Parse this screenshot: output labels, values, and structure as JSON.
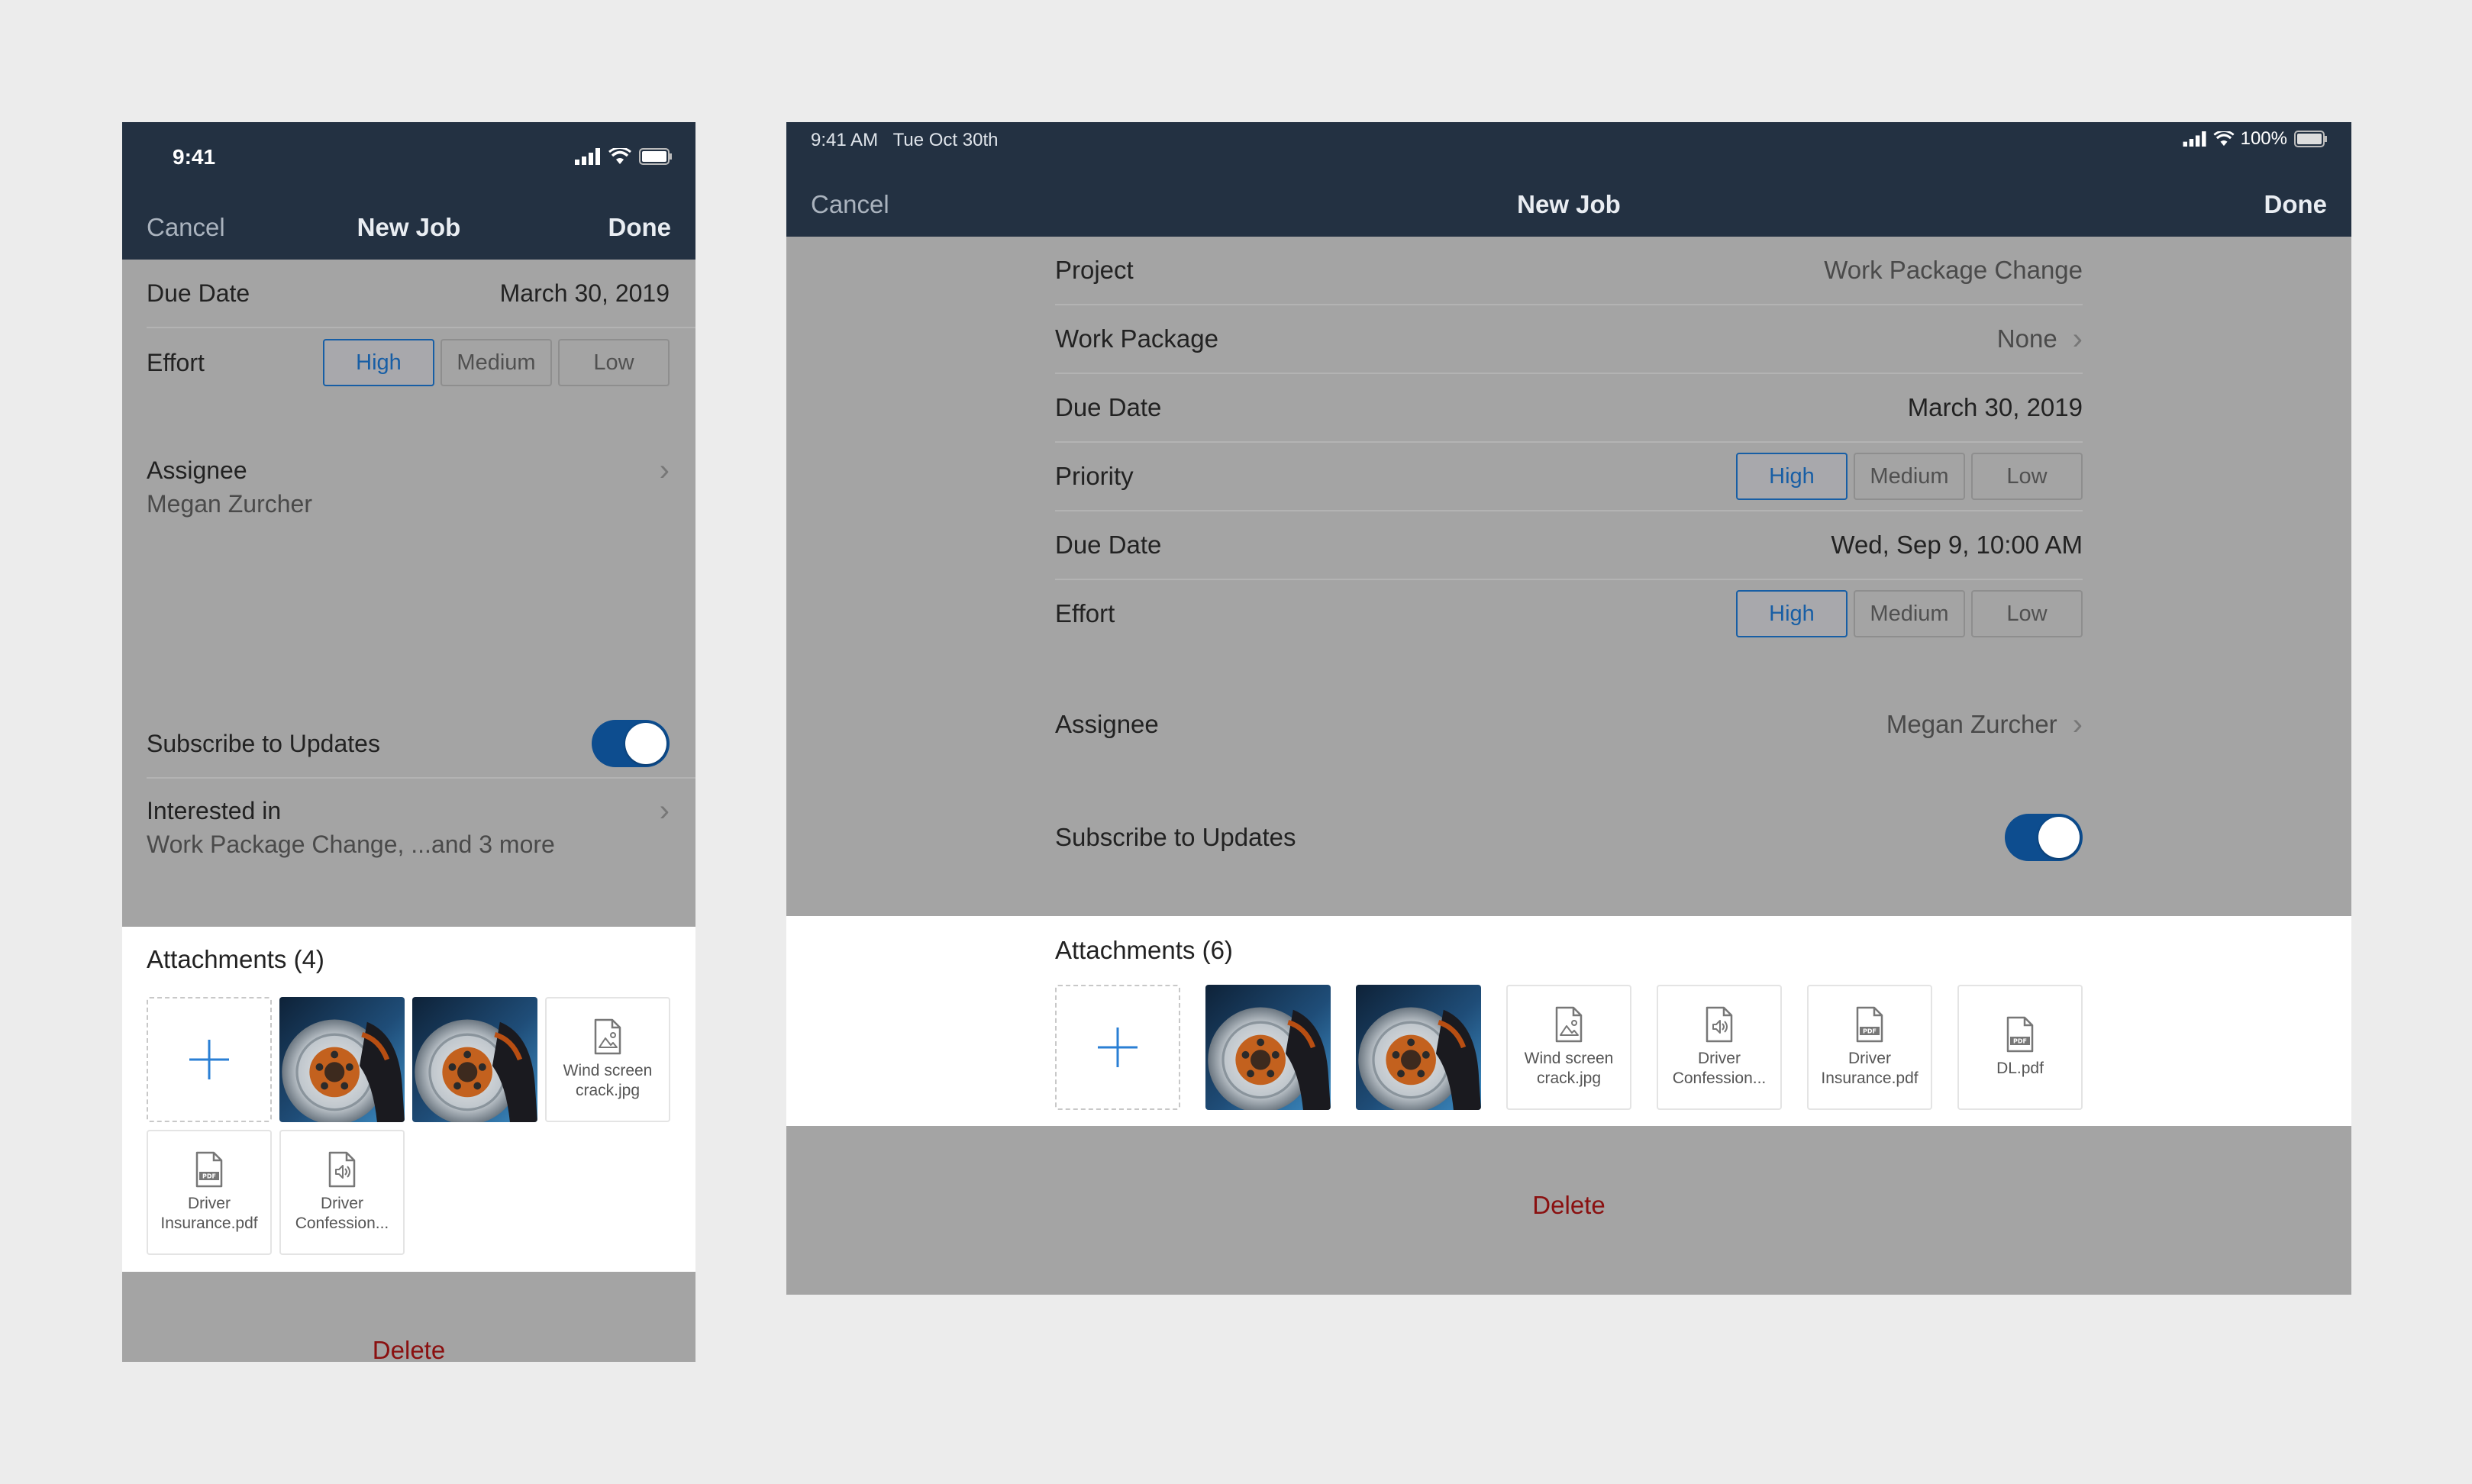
{
  "phone": {
    "status": {
      "time": "9:41"
    },
    "nav": {
      "cancel": "Cancel",
      "title": "New Job",
      "done": "Done"
    },
    "due_date": {
      "label": "Due Date",
      "value": "March 30, 2019"
    },
    "effort": {
      "label": "Effort",
      "options": [
        "High",
        "Medium",
        "Low"
      ],
      "selected": "High"
    },
    "assignee": {
      "label": "Assignee",
      "value": "Megan Zurcher"
    },
    "subscribe": {
      "label": "Subscribe to Updates",
      "on": true
    },
    "interested": {
      "label": "Interested in",
      "value": "Work Package Change, ...and 3 more"
    },
    "attachments": {
      "title": "Attachments (4)",
      "files": [
        {
          "name_l1": "Wind screen",
          "name_l2": "crack.jpg",
          "icon": "image-file-icon"
        },
        {
          "name_l1": "Driver",
          "name_l2": "Insurance.pdf",
          "icon": "pdf-file-icon"
        },
        {
          "name_l1": "Driver",
          "name_l2": "Confession...",
          "icon": "audio-file-icon"
        }
      ]
    },
    "delete": "Delete"
  },
  "tablet": {
    "status": {
      "time_date": "9:41 AM   Tue Oct 30th",
      "battery": "100%"
    },
    "nav": {
      "cancel": "Cancel",
      "title": "New Job",
      "done": "Done"
    },
    "project": {
      "label": "Project",
      "value": "Work Package Change"
    },
    "work_package": {
      "label": "Work Package",
      "value": "None"
    },
    "due_date": {
      "label": "Due Date",
      "value": "March 30, 2019"
    },
    "priority": {
      "label": "Priority",
      "options": [
        "High",
        "Medium",
        "Low"
      ],
      "selected": "High"
    },
    "due_date2": {
      "label": "Due Date",
      "value": "Wed, Sep 9, 10:00 AM"
    },
    "effort": {
      "label": "Effort",
      "options": [
        "High",
        "Medium",
        "Low"
      ],
      "selected": "High"
    },
    "assignee": {
      "label": "Assignee",
      "value": "Megan Zurcher"
    },
    "subscribe": {
      "label": "Subscribe to Updates",
      "on": true
    },
    "attachments": {
      "title": "Attachments (6)",
      "files": [
        {
          "name_l1": "Wind screen",
          "name_l2": "crack.jpg",
          "icon": "image-file-icon"
        },
        {
          "name_l1": "Driver",
          "name_l2": "Confession...",
          "icon": "audio-file-icon"
        },
        {
          "name_l1": "Driver",
          "name_l2": "Insurance.pdf",
          "icon": "pdf-file-icon"
        },
        {
          "name_l1": "DL.pdf",
          "name_l2": "",
          "icon": "pdf-file-icon"
        }
      ]
    },
    "delete": "Delete"
  },
  "colors": {
    "nav_bg": "#233142",
    "accent": "#175ea5",
    "toggle": "#0d4d8f",
    "delete": "#8a1010",
    "overlay": "#a4a4a4"
  }
}
